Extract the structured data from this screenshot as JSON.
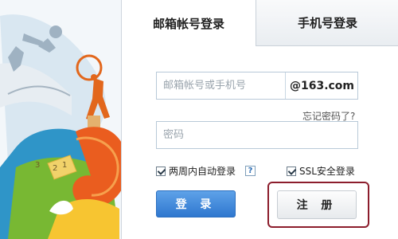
{
  "tabs": {
    "email_login": "邮箱帐号登录",
    "phone_login": "手机号登录"
  },
  "account": {
    "placeholder": "邮箱帐号或手机号",
    "domain": "@163.com"
  },
  "forgot_password": "忘记密码了?",
  "password": {
    "placeholder": "密码"
  },
  "options": {
    "auto_login": "两周内自动登录",
    "help": "?",
    "ssl_login": "SSL安全登录"
  },
  "buttons": {
    "login": "登 录",
    "register": "注 册"
  }
}
